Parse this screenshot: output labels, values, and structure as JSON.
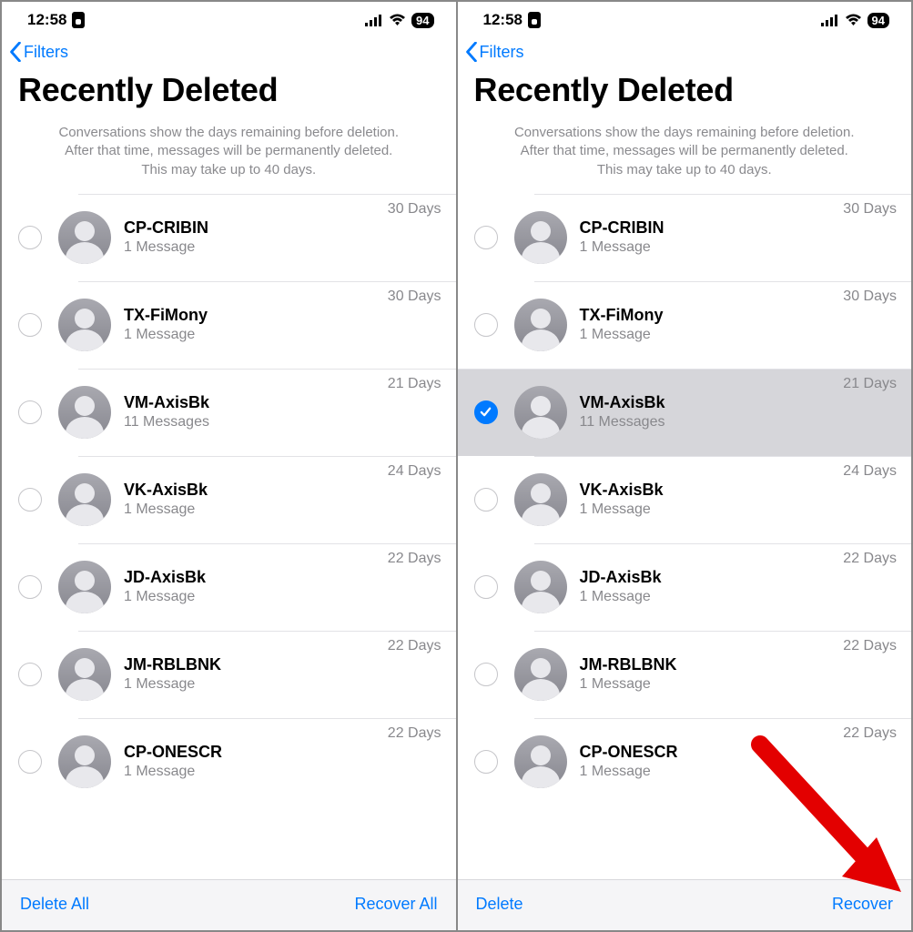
{
  "status": {
    "time": "12:58",
    "battery": "94"
  },
  "nav": {
    "back_label": "Filters"
  },
  "header": {
    "title": "Recently Deleted",
    "description_line1": "Conversations show the days remaining before deletion.",
    "description_line2": "After that time, messages will be permanently deleted.",
    "description_line3": "This may take up to 40 days."
  },
  "conversations": [
    {
      "name": "CP-CRIBIN",
      "sub": "1 Message",
      "days": "30 Days"
    },
    {
      "name": "TX-FiMony",
      "sub": "1 Message",
      "days": "30 Days"
    },
    {
      "name": "VM-AxisBk",
      "sub": "11 Messages",
      "days": "21 Days"
    },
    {
      "name": "VK-AxisBk",
      "sub": "1 Message",
      "days": "24 Days"
    },
    {
      "name": "JD-AxisBk",
      "sub": "1 Message",
      "days": "22 Days"
    },
    {
      "name": "JM-RBLBNK",
      "sub": "1 Message",
      "days": "22 Days"
    },
    {
      "name": "CP-ONESCR",
      "sub": "1 Message",
      "days": "22 Days"
    }
  ],
  "left_panel": {
    "selected_index": -1,
    "bottom_left": "Delete All",
    "bottom_right": "Recover All"
  },
  "right_panel": {
    "selected_index": 2,
    "bottom_left": "Delete",
    "bottom_right": "Recover"
  }
}
